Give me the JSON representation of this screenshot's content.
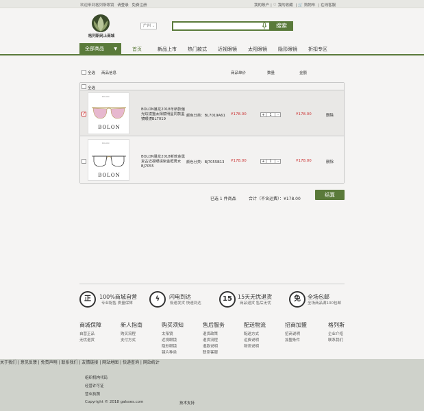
{
  "topbar": {
    "welcome": "欢迎来到格列斯眼镜",
    "login": "请登录",
    "register": "免费注册",
    "my_account": "我的账户",
    "favorites": "我的收藏",
    "cart": "购物车",
    "service": "在线客服"
  },
  "header": {
    "logo_text": "格列斯网上商城",
    "city": "广州",
    "search_placeholder": "",
    "search_button": "搜索"
  },
  "nav": {
    "all_products": "全部商品",
    "items": [
      "首页",
      "新品上市",
      "热门款式",
      "近视眼镜",
      "太阳眼镜",
      "隐形眼镜",
      "折扣专区"
    ]
  },
  "cart": {
    "select_all": "全选",
    "columns": {
      "product": "商品信息",
      "unit_price": "商品单价",
      "quantity": "数量",
      "amount": "金额"
    },
    "box_select_all": "全选",
    "items": [
      {
        "brand": "BOLON",
        "name": "BOLON暴龙2018年新款偏光炫镜猫太阳镜明星同款墨镜眼镜BL7019",
        "attr": "颜色分类：BL7019A61",
        "price": "¥178.00",
        "qty": "1",
        "total": "¥178.00",
        "delete": "删除",
        "checked": true
      },
      {
        "brand": "BOLON",
        "name": "BOLON暴龙2018新款金属复古近视眼镜架金框男女BJ7055",
        "attr": "颜色分类：BJ7055B13",
        "price": "¥178.00",
        "qty": "1",
        "total": "¥178.00",
        "delete": "删除",
        "checked": false
      }
    ],
    "summary_selected": "已选 1 件商品",
    "summary_total": "合计（不含运费）：¥178.00",
    "checkout": "结算"
  },
  "services": [
    {
      "icon": "正",
      "title": "100%商城自营",
      "sub": "专业配售 质量保障"
    },
    {
      "icon": "ϟ",
      "title": "闪电到达",
      "sub": "极速发货 快速到达"
    },
    {
      "icon": "15",
      "title": "15天无忧退货",
      "sub": "商品退货 售后无忧"
    },
    {
      "icon": "免",
      "title": "全场包邮",
      "sub": "全场商品满100包邮"
    }
  ],
  "footer_cols": [
    {
      "title": "商城保障",
      "items": [
        "自营正品",
        "无忧退货"
      ]
    },
    {
      "title": "新人指南",
      "items": [
        "购买流程",
        "支付方式"
      ]
    },
    {
      "title": "购买须知",
      "items": [
        "太阳镜",
        "近视眼镜",
        "隐形眼镜",
        "镜片种类"
      ]
    },
    {
      "title": "售后服务",
      "items": [
        "退货政策",
        "退货流程",
        "退款说明",
        "联系客服"
      ]
    },
    {
      "title": "配送物流",
      "items": [
        "配送方式",
        "运费说明",
        "物流说明"
      ]
    },
    {
      "title": "招商加盟",
      "items": [
        "招商说明",
        "加盟条件"
      ]
    },
    {
      "title": "格列斯",
      "items": [
        "企业介绍",
        "联系我们"
      ]
    }
  ],
  "footer": {
    "links": "关于我们 | 意见反馈 | 免责声明 | 联系我们 | 友情链接 | 网站地图 | 快递查询 | 网站统计",
    "org_code": "组织机构代码",
    "license": "经营许可证",
    "business": "营业执照",
    "copyright": "Copyright © 2018 galsses.com",
    "tech": "技术支持"
  }
}
